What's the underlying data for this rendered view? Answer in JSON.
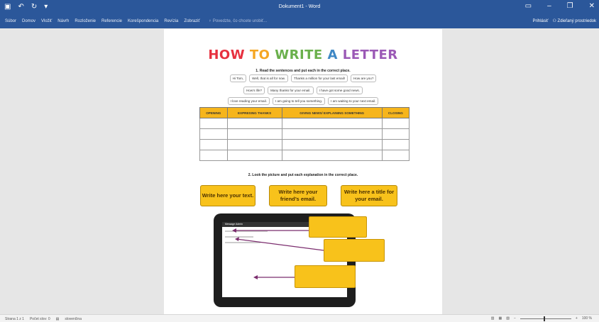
{
  "app": {
    "title": "Dokument1 - Word",
    "qat": {
      "save_icon": "save-icon",
      "undo_icon": "undo-icon",
      "redo_icon": "redo-icon"
    },
    "window_controls": [
      "ribbon-display-icon",
      "minimize-icon",
      "restore-icon",
      "close-icon"
    ]
  },
  "ribbon": {
    "tabs": [
      "Súbor",
      "Domov",
      "Vložiť",
      "Návrh",
      "Rozloženie",
      "Referencie",
      "Korešpondencia",
      "Revízia",
      "Zobraziť"
    ],
    "tell_me": "Povedzte, čo chcete urobiť...",
    "sign_in": "Prihlásiť",
    "share": "Zdieľaný prostriedok"
  },
  "document": {
    "heading": {
      "w1": "HOW",
      "w2": "TO",
      "w3": "WRITE",
      "w4": "A",
      "w5": "LETTER"
    },
    "q1": "1.  Read the sentences and put each in the correct place.",
    "chips_row1": [
      "Hi Tom,",
      "Well, that is all for now.",
      "Thanks a million for your last email!",
      "How are you?"
    ],
    "chips_row2": [
      "How’s life?",
      "Many thanks for your email.",
      "I have got some good news."
    ],
    "chips_row3": [
      "I love reading your email.",
      "I am going to tell you something.",
      "I am waiting to your next email."
    ],
    "table": {
      "headers": [
        "OPENING",
        "EXPRESING THANKS",
        "GIVING NEWS/ EXPLAINING SOMETHING",
        "CLOSING"
      ],
      "empty_rows": 4
    },
    "q2": "2.  Look the picture and put each explanation in the correct place.",
    "boxes": [
      "Write here your text.",
      "Write here your friend’s email.",
      "Write here a title for your email."
    ],
    "tablet_header": "Message Admin"
  },
  "status": {
    "page": "Strana 1 z 1",
    "words": "Počet slov: 0",
    "language": "slovenčina",
    "zoom": "100 %",
    "accent": "#2b579a"
  }
}
